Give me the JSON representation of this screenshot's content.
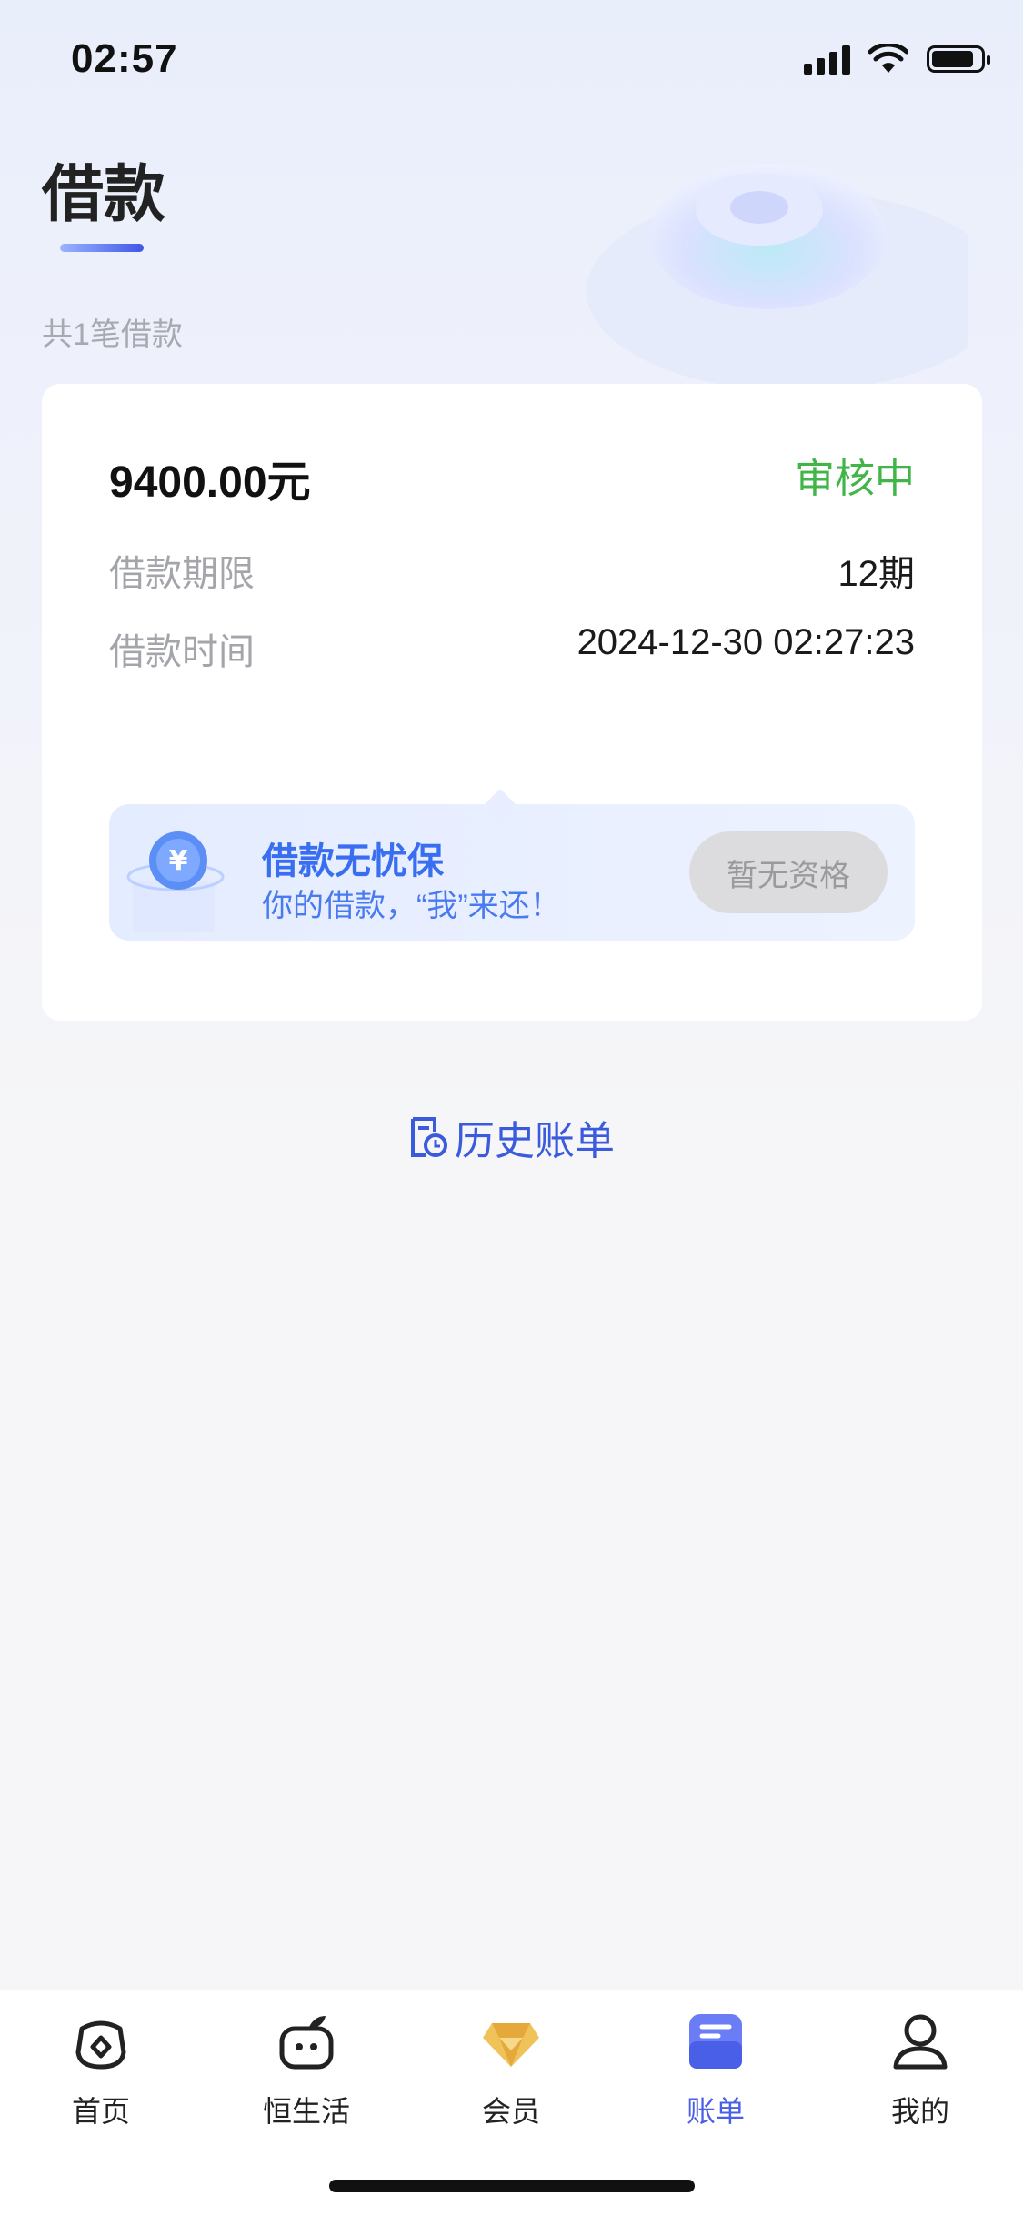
{
  "status_bar": {
    "time": "02:57"
  },
  "header": {
    "title": "借款",
    "loan_count": "共1笔借款"
  },
  "loan_card": {
    "amount": "9400.00元",
    "status": "审核中",
    "rows": [
      {
        "label": "借款期限",
        "value": "12期"
      },
      {
        "label": "借款时间",
        "value": "2024-12-30 02:27:23"
      }
    ],
    "insurance": {
      "title": "借款无忧保",
      "subtitle": "你的借款，“我”来还！",
      "button_label": "暂无资格"
    }
  },
  "history": {
    "label": "历史账单"
  },
  "tabbar": {
    "items": [
      {
        "label": "首页",
        "icon": "home-icon"
      },
      {
        "label": "恒生活",
        "icon": "life-icon"
      },
      {
        "label": "会员",
        "icon": "diamond-icon"
      },
      {
        "label": "账单",
        "icon": "bill-icon",
        "active": true
      },
      {
        "label": "我的",
        "icon": "profile-icon"
      }
    ]
  },
  "colors": {
    "accent": "#4a5fe8",
    "status_green": "#41b549",
    "insure_blue": "#3a6ef0"
  }
}
